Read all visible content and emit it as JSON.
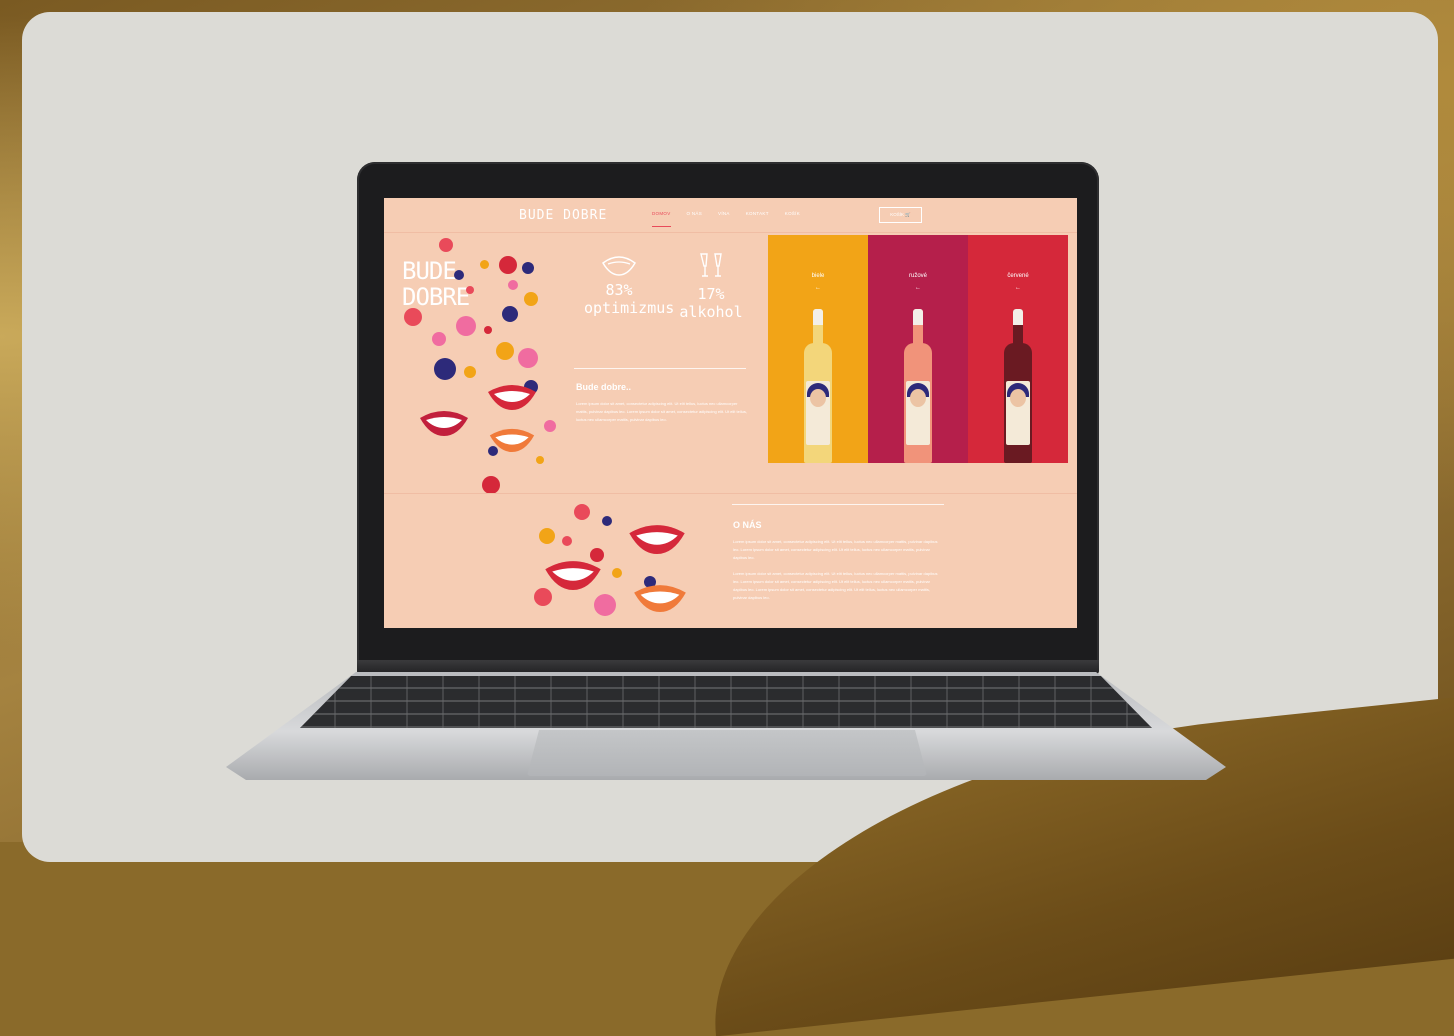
{
  "site": {
    "logo": "BUDE DOBRE",
    "nav": [
      "DOMOV",
      "O NÁS",
      "VÍNA",
      "KONTAKT",
      "KOŠÍK"
    ],
    "cart_label": "KOŠÍK 🛒",
    "hero_title_line1": "BUDE",
    "hero_title_line2": "DOBRE",
    "stats": [
      {
        "icon": "lips-icon",
        "value": "83%",
        "label": "optimizmus"
      },
      {
        "icon": "wine-glasses-icon",
        "value": "17%",
        "label": "alkohol"
      }
    ],
    "intro_heading": "Bude dobre..",
    "intro_text": "Lorem ipsum dolor sit amet, consectetur adipiscing elit. Ut elit tellus, luctus nec ullamcorper mattis, pulvinar dapibus leo. Lorem ipsum dolor sit amet, consectetur adipiscing elit. Ut elit tellus, luctus nec ullamcorper mattis, pulvinar dapibus leo.",
    "wines": [
      {
        "label": "biele",
        "arrow": "←",
        "panel_color": "#f2a417",
        "wine_color": "#f3d67a"
      },
      {
        "label": "ružové",
        "arrow": "←",
        "panel_color": "#b51f4b",
        "wine_color": "#f1937a"
      },
      {
        "label": "červené",
        "arrow": "←",
        "panel_color": "#d5283a",
        "wine_color": "#6a1a22"
      }
    ],
    "about_heading": "O NÁS",
    "about_text_1": "Lorem ipsum dolor sit amet, consectetur adipiscing elit. Ut elit tellus, luctus nec ullamcorper mattis, pulvinar dapibus leo. Lorem ipsum dolor sit amet, consectetur adipiscing elit. Ut elit tellus, luctus nec ullamcorper mattis, pulvinar dapibus leo.",
    "about_text_2": "Lorem ipsum dolor sit amet, consectetur adipiscing elit. Ut elit tellus, luctus nec ullamcorper mattis, pulvinar dapibus leo. Lorem ipsum dolor sit amet, consectetur adipiscing elit. Ut elit tellus, luctus nec ullamcorper mattis, pulvinar dapibus leo. Lorem ipsum dolor sit amet, consectetur adipiscing elit. Ut elit tellus, luctus nec ullamcorper mattis, pulvinar dapibus leo."
  },
  "colors": {
    "site_background": "#f6cdb4",
    "accent": "#e94a5a",
    "card_background": "#dcdbd6"
  }
}
